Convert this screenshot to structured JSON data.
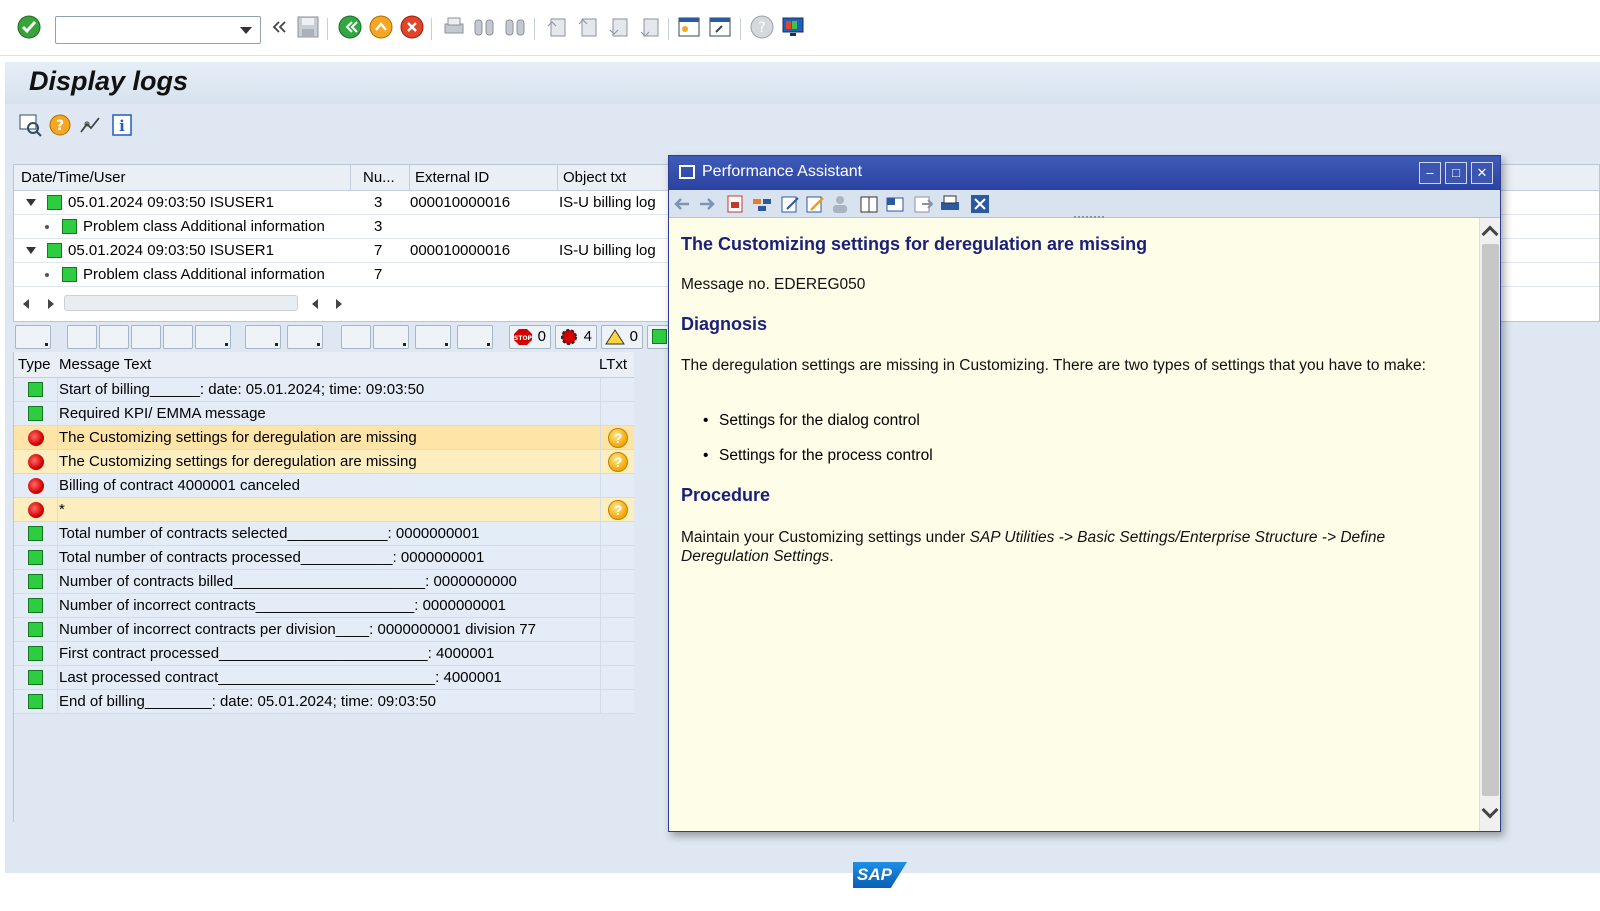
{
  "page": {
    "title": "Display logs"
  },
  "tree": {
    "columns": [
      "Date/Time/User",
      "Nu...",
      "External ID",
      "Object txt"
    ],
    "rows": [
      {
        "text": "05.01.2024  09:03:50  ISUSER1",
        "num": "3",
        "ext_id": "000010000016",
        "obj": "IS-U billing log"
      },
      {
        "text": "Problem class Additional information",
        "num": "3",
        "ext_id": "",
        "obj": ""
      },
      {
        "text": "05.01.2024  09:03:50  ISUSER1",
        "num": "7",
        "ext_id": "000010000016",
        "obj": "IS-U billing log"
      },
      {
        "text": "Problem class Additional information",
        "num": "7",
        "ext_id": "",
        "obj": ""
      }
    ]
  },
  "log_toolbar": {
    "stop_count": "0",
    "error_count": "4",
    "warning_count": "0"
  },
  "messages": {
    "columns": [
      "Type",
      "Message Text",
      "LTxt"
    ],
    "rows": [
      {
        "type": "success",
        "text": "Start of billing______: date: 05.01.2024; time: 09:03:50",
        "ltxt": false
      },
      {
        "type": "success",
        "text": "Required KPI/ EMMA message",
        "ltxt": false
      },
      {
        "type": "error",
        "text": "The Customizing settings for deregulation are missing",
        "ltxt": true
      },
      {
        "type": "error",
        "text": "The Customizing settings for deregulation are missing",
        "ltxt": true
      },
      {
        "type": "error",
        "text": "Billing of contract 4000001 canceled",
        "ltxt": false
      },
      {
        "type": "error",
        "text": "*",
        "ltxt": true
      },
      {
        "type": "success",
        "text": "Total number of contracts selected____________: 0000000001",
        "ltxt": false
      },
      {
        "type": "success",
        "text": "Total number of contracts processed___________: 0000000001",
        "ltxt": false
      },
      {
        "type": "success",
        "text": "Number of contracts billed_______________________: 0000000000",
        "ltxt": false
      },
      {
        "type": "success",
        "text": "Number of incorrect contracts___________________: 0000000001",
        "ltxt": false
      },
      {
        "type": "success",
        "text": "Number of incorrect contracts per division____: 0000000001 division 77",
        "ltxt": false
      },
      {
        "type": "success",
        "text": "First contract processed_________________________: 4000001",
        "ltxt": false
      },
      {
        "type": "success",
        "text": "Last processed contract__________________________: 4000001",
        "ltxt": false
      },
      {
        "type": "success",
        "text": "End of billing________: date: 05.01.2024; time: 09:03:50",
        "ltxt": false
      }
    ]
  },
  "popup": {
    "title": "Performance Assistant",
    "heading": "The Customizing settings for deregulation are missing",
    "message_no": "Message no. EDEREG050",
    "diagnosis_title": "Diagnosis",
    "diagnosis_text": "The deregulation settings are missing in Customizing. There are two types of settings that you have to make:",
    "bullets": [
      "Settings for the dialog control",
      "Settings for the process control"
    ],
    "procedure_title": "Procedure",
    "procedure_prefix": "Maintain your Customizing settings under ",
    "procedure_path": "SAP Utilities -> Basic Settings/Enterprise Structure -> Define Deregulation Settings",
    "procedure_suffix": "."
  },
  "footer": {
    "logo_text": "SAP"
  },
  "colors": {
    "success": "#2ecc40",
    "error": "#d40000",
    "heading": "#1a1f7a",
    "popup_bg": "#fdfde8",
    "popup_title": "#2b43a0"
  }
}
